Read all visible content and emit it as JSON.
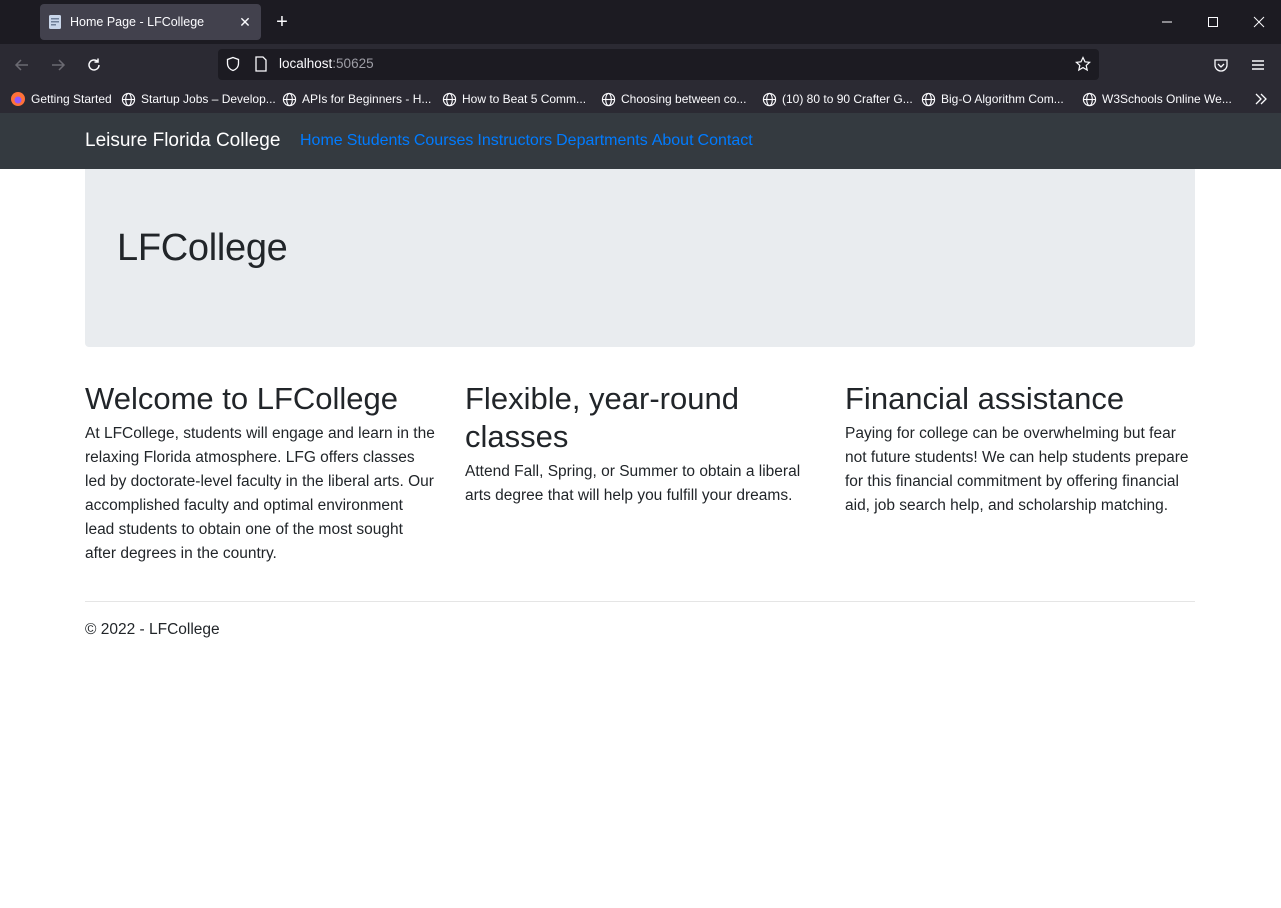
{
  "browser": {
    "tab_title": "Home Page - LFCollege",
    "new_tab_label": "+",
    "url_host": "localhost",
    "url_port": ":50625",
    "bookmarks": [
      "Getting Started",
      "Startup Jobs – Develop...",
      "APIs for Beginners - H...",
      "How to Beat 5 Comm...",
      "Choosing between co...",
      "(10) 80 to 90 Crafter G...",
      "Big-O Algorithm Com...",
      "W3Schools Online We..."
    ]
  },
  "site": {
    "brand": "Leisure Florida College",
    "nav": [
      "Home",
      "Students",
      "Courses",
      "Instructors",
      "Departments",
      "About",
      "Contact"
    ],
    "jumbotron_title": "LFCollege",
    "columns": [
      {
        "heading": "Welcome to LFCollege",
        "text": "At LFCollege, students will engage and learn in the relaxing Florida atmosphere. LFG offers classes led by doctorate-level faculty in the liberal arts. Our accomplished faculty and optimal environment lead students to obtain one of the most sought after degrees in the country."
      },
      {
        "heading": "Flexible, year-round classes",
        "text": "Attend Fall, Spring, or Summer to obtain a liberal arts degree that will help you fulfill your dreams."
      },
      {
        "heading": "Financial assistance",
        "text": "Paying for college can be overwhelming but fear not future students! We can help students prepare for this financial commitment by offering financial aid, job search help, and scholarship matching."
      }
    ],
    "footer": "© 2022 - LFCollege"
  },
  "colors": {
    "chrome_dark": "#1c1b22",
    "chrome_toolbar": "#2b2a33",
    "site_nav_bg": "#343a40",
    "link_blue": "#007bff",
    "jumbotron_bg": "#e9ecef"
  }
}
